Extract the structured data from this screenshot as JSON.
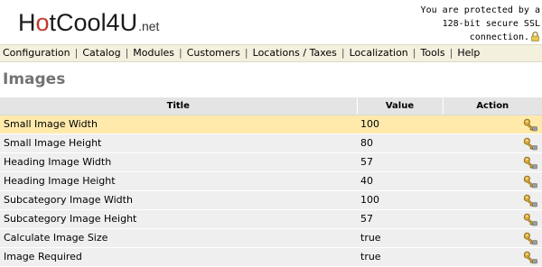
{
  "header": {
    "logo_text": "HotCool4U",
    "logo_suffix": ".net",
    "ssl_lines": [
      "You are protected by a",
      "128-bit secure SSL",
      "connection."
    ],
    "icons": {
      "ssl": "lock-icon"
    }
  },
  "nav": {
    "items": [
      "Configuration",
      "Catalog",
      "Modules",
      "Customers",
      "Locations / Taxes",
      "Localization",
      "Tools",
      "Help"
    ]
  },
  "page": {
    "title": "Images"
  },
  "table": {
    "columns": [
      "Title",
      "Value",
      "Action"
    ],
    "rows": [
      {
        "title": "Small Image Width",
        "value": "100",
        "selected": true
      },
      {
        "title": "Small Image Height",
        "value": "80",
        "selected": false
      },
      {
        "title": "Heading Image Width",
        "value": "57",
        "selected": false
      },
      {
        "title": "Heading Image Height",
        "value": "40",
        "selected": false
      },
      {
        "title": "Subcategory Image Width",
        "value": "100",
        "selected": false
      },
      {
        "title": "Subcategory Image Height",
        "value": "57",
        "selected": false
      },
      {
        "title": "Calculate Image Size",
        "value": "true",
        "selected": false
      },
      {
        "title": "Image Required",
        "value": "true",
        "selected": false
      }
    ],
    "action_icon": "edit-icon"
  },
  "colors": {
    "nav_bg": "#f3f0de",
    "header_bg": "#e4e4e4",
    "row_bg": "#efefef",
    "selected_row_bg": "#ffe9ab",
    "title_color": "#737373"
  }
}
